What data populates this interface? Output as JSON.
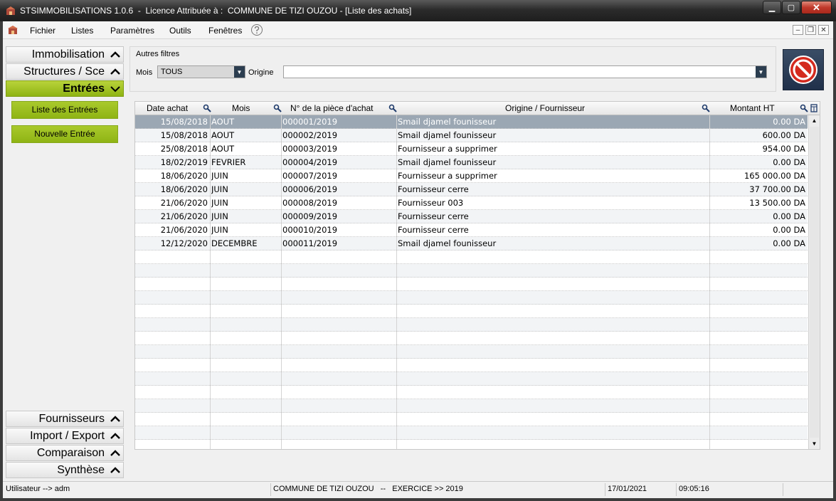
{
  "window": {
    "title": "STSIMMOBILISATIONS 1.0.6  -  Licence Attribuée à :  COMMUNE DE TIZI OUZOU - [Liste des achats]",
    "minimize": "▁",
    "maximize": "▢",
    "close": "✕"
  },
  "menu": {
    "items": [
      "Fichier",
      "Listes",
      "Paramètres",
      "Outils",
      "Fenêtres"
    ],
    "mdi_min": "–",
    "mdi_restore": "❐",
    "mdi_close": "✕"
  },
  "sidebar": {
    "top_sections": [
      "Immobilisation",
      "Structures / Sce"
    ],
    "active_section": "Entrées",
    "buttons": [
      "Liste des Entrées",
      "Nouvelle Entrée"
    ],
    "bottom_sections": [
      "Fournisseurs",
      "Import / Export",
      "Comparaison",
      "Synthèse"
    ]
  },
  "filters": {
    "legend": "Autres filtres",
    "mois_label": "Mois",
    "mois_value": "TOUS",
    "origine_label": "Origine",
    "origine_value": ""
  },
  "table": {
    "columns": [
      "Date achat",
      "Mois",
      "N° de la pièce d'achat",
      "Origine / Fournisseur",
      "Montant HT"
    ],
    "rows": [
      [
        "15/08/2018",
        "AOUT",
        "000001/2019",
        "Smail djamel founisseur",
        "0.00 DA"
      ],
      [
        "15/08/2018",
        "AOUT",
        "000002/2019",
        "Smail djamel founisseur",
        "600.00 DA"
      ],
      [
        "25/08/2018",
        "AOUT",
        "000003/2019",
        "Fournisseur a supprimer",
        "954.00 DA"
      ],
      [
        "18/02/2019",
        "FEVRIER",
        "000004/2019",
        "Smail djamel founisseur",
        "0.00 DA"
      ],
      [
        "18/06/2020",
        "JUIN",
        "000007/2019",
        "Fournisseur a supprimer",
        "165 000.00 DA"
      ],
      [
        "18/06/2020",
        "JUIN",
        "000006/2019",
        "Fournisseur cerre",
        "37 700.00 DA"
      ],
      [
        "21/06/2020",
        "JUIN",
        "000008/2019",
        "Fournisseur 003",
        "13 500.00 DA"
      ],
      [
        "21/06/2020",
        "JUIN",
        "000009/2019",
        "Fournisseur cerre",
        "0.00 DA"
      ],
      [
        "21/06/2020",
        "JUIN",
        "000010/2019",
        "Fournisseur cerre",
        "0.00 DA"
      ],
      [
        "12/12/2020",
        "DECEMBRE",
        "000011/2019",
        "Smail djamel founisseur",
        "0.00 DA"
      ]
    ],
    "selected_row": 0,
    "empty_rows": 14
  },
  "status": {
    "user": "Utilisateur --> adm",
    "org": "COMMUNE DE TIZI OUZOU   --   EXERCICE >> 2019",
    "date": "17/01/2021",
    "time": "09:05:16"
  },
  "colors": {
    "accent_green": "#9dbf22",
    "selected_row": "#9ba7b3",
    "combo_arrow": "#2c3e50"
  }
}
